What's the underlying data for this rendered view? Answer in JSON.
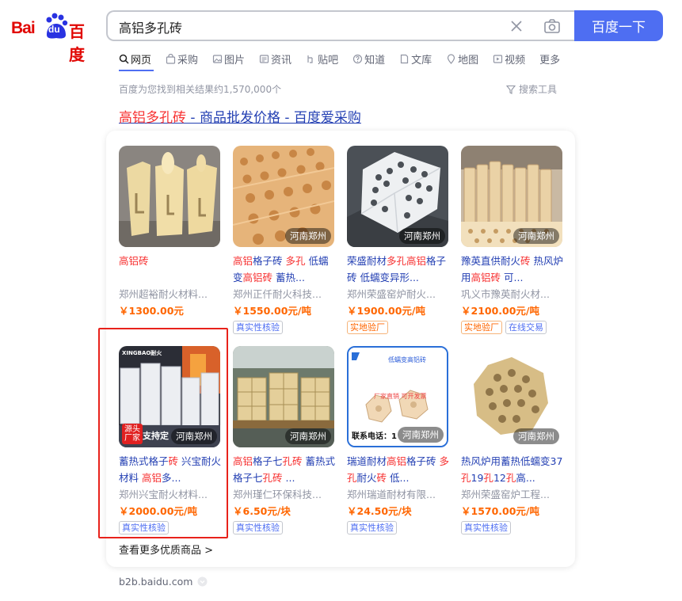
{
  "logo": {
    "text_bai": "Bai",
    "text_du": "du",
    "text_cn": "百度"
  },
  "search": {
    "query": "高铝多孔砖",
    "button_label": "百度一下"
  },
  "tabs": [
    {
      "label": "网页",
      "icon": "search-icon"
    },
    {
      "label": "采购",
      "icon": "shop-icon"
    },
    {
      "label": "图片",
      "icon": "image-icon"
    },
    {
      "label": "资讯",
      "icon": "news-icon"
    },
    {
      "label": "贴吧",
      "icon": "tieba-icon"
    },
    {
      "label": "知道",
      "icon": "question-icon"
    },
    {
      "label": "文库",
      "icon": "doc-icon"
    },
    {
      "label": "地图",
      "icon": "map-icon"
    },
    {
      "label": "视频",
      "icon": "video-icon"
    },
    {
      "label": "更多",
      "icon": ""
    }
  ],
  "results_info": {
    "count_text": "百度为您找到相关结果约1,570,000个",
    "tools_label": "搜索工具"
  },
  "result": {
    "title_highlight": "高铝多孔砖",
    "title_rest": " - 商品批发价格 - 百度爱采购",
    "more_link": "查看更多优质商品 >",
    "source": "b2b.baidu.com"
  },
  "products": [
    {
      "title_html": "<span class=\"hl\">高铝砖</span>",
      "shop": "郑州超裕耐火材料...",
      "price": "￥1300.00元",
      "location": "",
      "tags": []
    },
    {
      "title_html": "<span class=\"hl\">高铝</span>格子砖 <span class=\"hl\">多孔</span> 低蠕变<span class=\"hl\">高铝砖</span> 蓄热...",
      "shop": "郑州正仟耐火科技...",
      "price": "￥1550.00元/吨",
      "location": "河南郑州",
      "tags": [
        {
          "label": "真实性核验",
          "style": "blue"
        }
      ]
    },
    {
      "title_html": "荣盛耐材<span class=\"hl\">多孔高铝</span>格子砖 低蠕变异形...",
      "shop": "郑州荣盛窑炉耐火...",
      "price": "￥1900.00元/吨",
      "location": "河南郑州",
      "tags": [
        {
          "label": "实地验厂",
          "style": "orange"
        }
      ]
    },
    {
      "title_html": "豫英直供耐火<span class=\"hl\">砖</span> 热风炉用<span class=\"hl\">高铝砖</span> 可...",
      "shop": "巩义市豫英耐火材...",
      "price": "￥2100.00元/吨",
      "location": "河南郑州",
      "tags": [
        {
          "label": "实地验厂",
          "style": "orange"
        },
        {
          "label": "在线交易",
          "style": "blue"
        }
      ]
    },
    {
      "title_html": "蓄热式格子<span class=\"hl\">砖</span> 兴宝耐火材料 <span class=\"hl\">高铝</span>多...",
      "shop": "郑州兴宝耐火材料...",
      "price": "￥2000.00元/吨",
      "location": "河南郑州",
      "tags": [
        {
          "label": "真实性核验",
          "style": "blue"
        }
      ]
    },
    {
      "title_html": "<span class=\"hl\">高铝</span>格子七<span class=\"hl\">孔砖</span> 蓄热式格子七<span class=\"hl\">孔砖</span> ...",
      "shop": "郑州瑾仁环保科技...",
      "price": "￥6.50元/块",
      "location": "河南郑州",
      "tags": [
        {
          "label": "真实性核验",
          "style": "blue"
        }
      ]
    },
    {
      "title_html": "瑞道耐材<span class=\"hl\">高铝</span>格子砖 <span class=\"hl\">多孔</span>耐火<span class=\"hl\">砖</span> 低...",
      "shop": "郑州瑞道耐材有限...",
      "price": "￥24.50元/块",
      "location": "河南郑州",
      "tags": [
        {
          "label": "真实性核验",
          "style": "blue"
        }
      ]
    },
    {
      "title_html": "热风炉用蓄热低蠕变37<span class=\"hl\">孔</span>19<span class=\"hl\">孔</span>12<span class=\"hl\">孔</span>高...",
      "shop": "郑州荣盛窑炉工程...",
      "price": "￥1570.00元/吨",
      "location": "河南郑州",
      "tags": [
        {
          "label": "真实性核验",
          "style": "blue"
        }
      ]
    }
  ],
  "image_overlays": {
    "p5_badge": "源头\n厂家",
    "p5_support": "支持定",
    "p5_brand": "XINGBAO耐火",
    "p7_top": "低蠕变高铝砖",
    "p7_mid": "厂家直销   可开发票",
    "p7_phone": "联系电话：1"
  }
}
